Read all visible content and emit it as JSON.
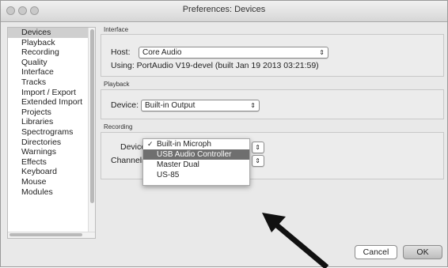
{
  "window": {
    "title": "Preferences: Devices"
  },
  "sidebar": {
    "items": [
      {
        "label": "Devices"
      },
      {
        "label": "Playback"
      },
      {
        "label": "Recording"
      },
      {
        "label": "Quality"
      },
      {
        "label": "Interface"
      },
      {
        "label": "Tracks"
      },
      {
        "label": "Import / Export"
      },
      {
        "label": "Extended Import"
      },
      {
        "label": "Projects"
      },
      {
        "label": "Libraries"
      },
      {
        "label": "Spectrograms"
      },
      {
        "label": "Directories"
      },
      {
        "label": "Warnings"
      },
      {
        "label": "Effects"
      },
      {
        "label": "Keyboard"
      },
      {
        "label": "Mouse"
      },
      {
        "label": "Modules"
      }
    ],
    "selected": "Devices"
  },
  "interface": {
    "section_label": "Interface",
    "host_label": "Host:",
    "host_value": "Core Audio",
    "using_text": "Using: PortAudio V19-devel (built Jan 19 2013 03:21:59)"
  },
  "playback": {
    "section_label": "Playback",
    "device_label": "Device:",
    "device_value": "Built-in Output"
  },
  "recording": {
    "section_label": "Recording",
    "device_label": "Device",
    "channels_label": "Channels",
    "dropdown_options": [
      {
        "label": "Built-in Microph",
        "checked": true,
        "highlighted": false
      },
      {
        "label": "USB Audio Controller",
        "checked": false,
        "highlighted": true
      },
      {
        "label": "Master Dual",
        "checked": false,
        "highlighted": false
      },
      {
        "label": "US-85",
        "checked": false,
        "highlighted": false
      }
    ]
  },
  "buttons": {
    "cancel": "Cancel",
    "ok": "OK"
  },
  "icons": {
    "check": "✓",
    "stepper": "⇕",
    "arrow": "pointer-arrow"
  },
  "colors": {
    "menu_highlight": "#6f6f6f",
    "selected_sidebar": "#cfcfcf",
    "arrow": "#111111"
  }
}
